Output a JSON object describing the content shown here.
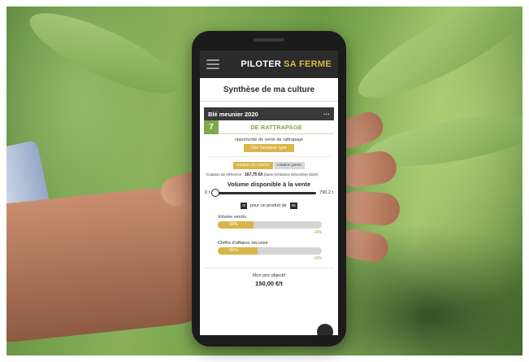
{
  "app": {
    "brand_part1": "PILOTER",
    "brand_part2": "SA FERME"
  },
  "page": {
    "title": "Synthèse de ma culture"
  },
  "crop_card": {
    "name": "Blé meunier 2020",
    "menu_label": "···",
    "score": "7",
    "score_label": "DE RATTRAPAGE",
    "opportunity_text": "opportunité de vente de rattrapage",
    "analyse_button": "Voir l'analyse type"
  },
  "quotation": {
    "tabs": [
      {
        "label": "cotation du marché",
        "active": true
      },
      {
        "label": "cotation perso",
        "active": false
      }
    ],
    "reference_prefix": "Cotation de référence :",
    "reference_value": "167,75 €/t",
    "reference_suffix": "(base échéance Décembre 2020)"
  },
  "volume": {
    "title": "Volume disponible à la vente",
    "min_label": "0 t",
    "max_label": "790,2 t",
    "slider_fraction": 0.0,
    "qty_box": "0t",
    "produit_text": "pour un produit de",
    "price_box": "0€"
  },
  "metrics": [
    {
      "label": "Volume vendu",
      "value_label": "34%",
      "fraction": 0.34,
      "delta": "+0%"
    },
    {
      "label": "Chiffre d'affaires sécurisé",
      "value_label": "38%",
      "fraction": 0.38,
      "delta": "+0%"
    }
  ],
  "objective": {
    "label": "Mon prix objectif",
    "value": "150,00 €/t"
  },
  "colors": {
    "accent_gold": "#d9b64a",
    "accent_green": "#7fa84a",
    "dark": "#2b2b2b"
  }
}
